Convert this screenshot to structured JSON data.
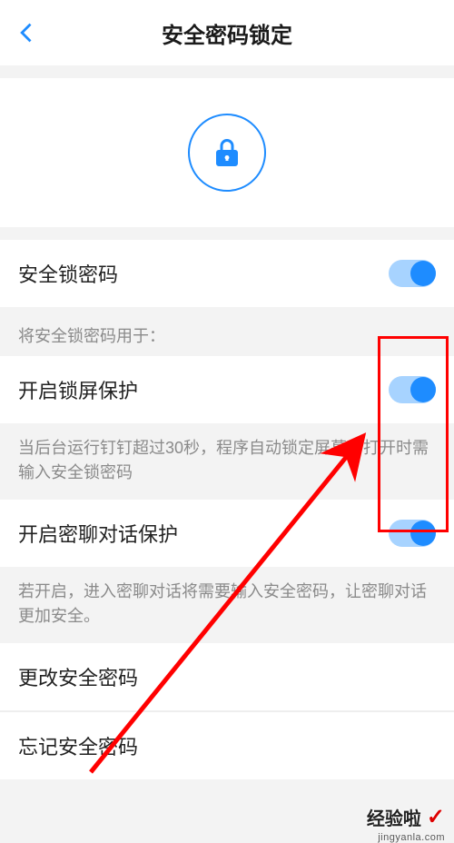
{
  "header": {
    "title": "安全密码锁定"
  },
  "main_toggle": {
    "label": "安全锁密码",
    "on": true
  },
  "section_title": "将安全锁密码用于：",
  "lock_screen": {
    "label": "开启锁屏保护",
    "on": true,
    "desc": "当后台运行钉钉超过30秒，程序自动锁定屏幕，打开时需输入安全锁密码"
  },
  "private_chat": {
    "label": "开启密聊对话保护",
    "on": true,
    "desc": "若开启，进入密聊对话将需要输入安全密码，让密聊对话更加安全。"
  },
  "change_pw": {
    "label": "更改安全密码"
  },
  "forgot_pw": {
    "label": "忘记安全密码"
  },
  "watermark": {
    "brand": "经验啦",
    "url": "jingyanla.com"
  }
}
